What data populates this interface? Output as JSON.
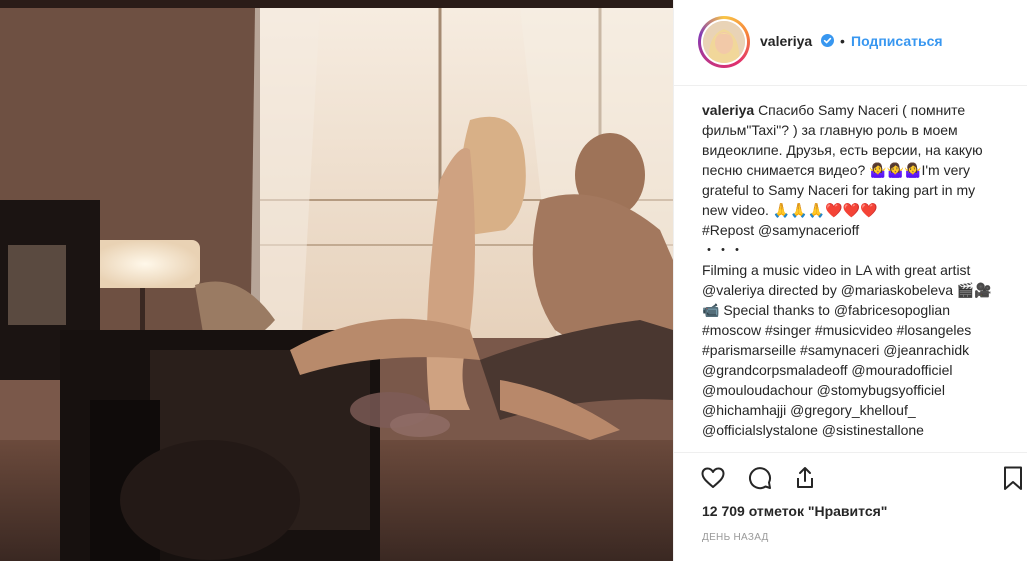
{
  "header": {
    "username": "valeriya",
    "separator": "•",
    "follow_label": "Подписаться"
  },
  "caption": {
    "username": "valeriya",
    "lines": [
      "Спасибо Samy Naceri ( помните фильм\"Taxi\"? ) за главную роль в моем видеоклипе. Друзья, есть версии, на какую песню снимается видео? 🤷‍♀️🤷‍♀️🤷‍♀️I'm very grateful to Samy Naceri for taking part in my new video. 🙏🙏🙏❤️❤️❤️",
      "#Repost @samynacerioff",
      "・・・",
      "Filming a music video in LA with great artist @valeriya directed by @mariaskobeleva 🎬🎥📹 Special thanks to @fabricesopoglian #moscow #singer #musicvideo #losangeles #parismarseille #samynaceri @jeanrachidk @grandcorpsmaladeoff @mouradofficiel @mouloudachour @stomybugsyofficiel @hichamhajji @gregory_khellouf_ @officialslystalone @sistinestallone"
    ]
  },
  "actions": {
    "icons": [
      "heart-icon",
      "comment-icon",
      "share-icon",
      "bookmark-icon"
    ],
    "likes_text": "12 709 отметок \"Нравится\"",
    "time_text": "ДЕНЬ НАЗАД"
  },
  "colors": {
    "accent": "#3897f0",
    "text": "#262626",
    "muted": "#999999",
    "link": "#003569"
  }
}
